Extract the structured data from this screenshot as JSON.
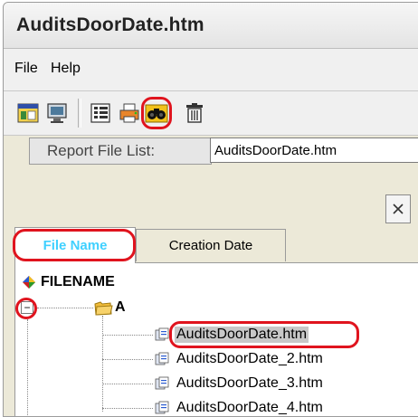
{
  "window": {
    "title": "AuditsDoorDate.htm"
  },
  "menu": {
    "items": [
      "File",
      "Help"
    ]
  },
  "toolbar": {
    "buttons": [
      {
        "icon": "window-icon",
        "label": ""
      },
      {
        "icon": "monitor-icon",
        "label": ""
      },
      {
        "icon": "list-icon",
        "label": ""
      },
      {
        "icon": "printer-icon",
        "label": ""
      },
      {
        "icon": "binoculars-icon",
        "label": ""
      },
      {
        "icon": "trash-icon",
        "label": ""
      }
    ]
  },
  "report": {
    "label": "Report File List:",
    "value": "AuditsDoorDate.htm"
  },
  "tabs": [
    {
      "label": "File Name",
      "active": true
    },
    {
      "label": "Creation Date",
      "active": false
    }
  ],
  "tree": {
    "root": "FILENAME",
    "folder": "A",
    "files": [
      "AuditsDoorDate.htm",
      "AuditsDoorDate_2.htm",
      "AuditsDoorDate_3.htm",
      "AuditsDoorDate_4.htm"
    ],
    "expander": "−"
  },
  "colors": {
    "highlight": "#e0141e",
    "active_tab_text": "#3fd0ff",
    "selection": "#c8c8c8"
  }
}
